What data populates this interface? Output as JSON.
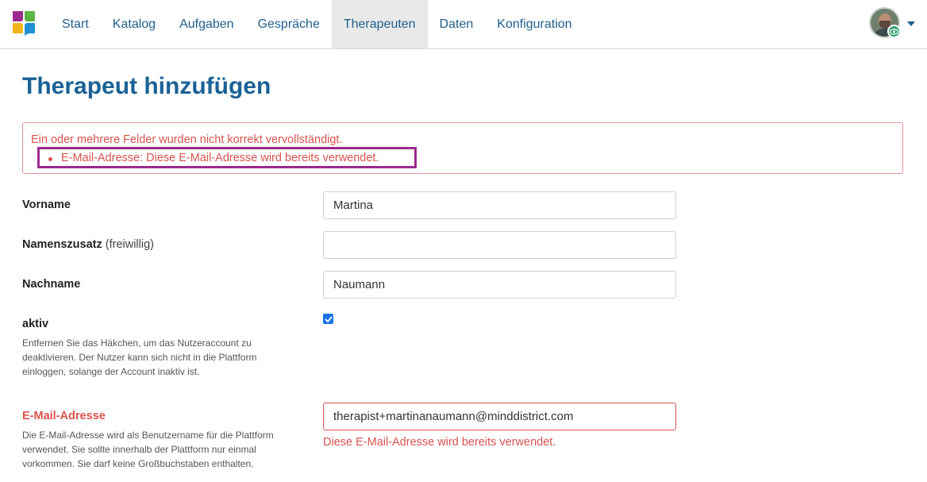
{
  "nav": {
    "items": [
      {
        "label": "Start",
        "active": false
      },
      {
        "label": "Katalog",
        "active": false
      },
      {
        "label": "Aufgaben",
        "active": false
      },
      {
        "label": "Gespräche",
        "active": false
      },
      {
        "label": "Therapeuten",
        "active": true
      },
      {
        "label": "Daten",
        "active": false
      },
      {
        "label": "Konfiguration",
        "active": false
      }
    ]
  },
  "page": {
    "title": "Therapeut hinzufügen"
  },
  "errors": {
    "summary": "Ein oder mehrere Felder wurden nicht korrekt vervollständigt.",
    "items": [
      "E-Mail-Adresse: Diese E-Mail-Adresse wird bereits verwendet."
    ]
  },
  "form": {
    "firstname": {
      "label": "Vorname",
      "value": "Martina"
    },
    "name_suffix": {
      "label": "Namenszusatz",
      "optional": "(freiwillig)",
      "value": ""
    },
    "lastname": {
      "label": "Nachname",
      "value": "Naumann"
    },
    "active": {
      "label": "aktiv",
      "checked": true,
      "help": "Entfernen Sie das Häkchen, um das Nutzeraccount zu deaktivieren. Der Nutzer kann sich nicht in die Plattform einloggen, solange der Account inaktiv ist."
    },
    "email": {
      "label": "E-Mail-Adresse",
      "value": "therapist+martinanaumann@minddistrict.com",
      "help": "Die E-Mail-Adresse wird als Benutzername für die Plattform verwendet. Sie sollte innerhalb der Plattform nur einmal vorkommen. Sie darf keine Großbuchstaben enthalten.",
      "error": "Diese E-Mail-Adresse wird bereits verwendet."
    }
  },
  "colors": {
    "brand": "#1a6296",
    "error": "#d9534f",
    "highlight": "#9b2a8f",
    "nav_active_bg": "#e9e9e9"
  }
}
